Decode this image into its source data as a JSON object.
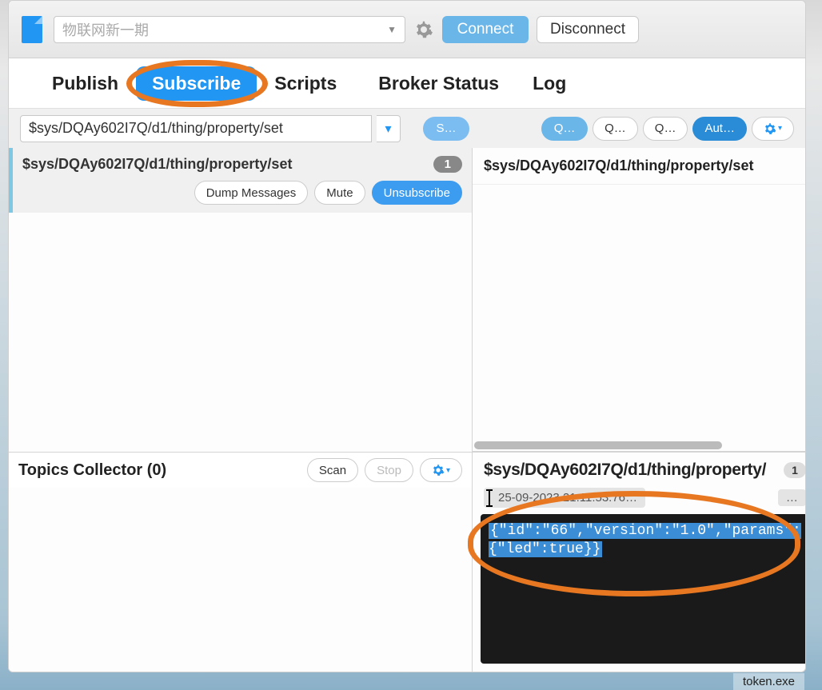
{
  "toolbar": {
    "connection_placeholder": "物联网新一期",
    "connect_label": "Connect",
    "disconnect_label": "Disconnect"
  },
  "tabs": {
    "publish": "Publish",
    "subscribe": "Subscribe",
    "scripts": "Scripts",
    "broker": "Broker Status",
    "log": "Log"
  },
  "subbar": {
    "topic": "$sys/DQAy602I7Q/d1/thing/property/set",
    "subscribe_btn": "S…",
    "q_btn": "Q…",
    "aut_btn": "Aut…"
  },
  "subscription": {
    "topic": "$sys/DQAy602I7Q/d1/thing/property/set",
    "count": "1",
    "dump": "Dump Messages",
    "mute": "Mute",
    "unsubscribe": "Unsubscribe"
  },
  "right_panel": {
    "topic": "$sys/DQAy602I7Q/d1/thing/property/set"
  },
  "collector": {
    "title": "Topics Collector (0)",
    "scan": "Scan",
    "stop": "Stop"
  },
  "message": {
    "topic": "$sys/DQAy602I7Q/d1/thing/property/",
    "count": "1",
    "timestamp": "25-09-2023  21:11:53.76…",
    "more": "…",
    "payload": "{\"id\":\"66\",\"version\":\"1.0\",\"params\":{\"led\":true}}"
  },
  "taskbar": {
    "item": "token.exe"
  }
}
